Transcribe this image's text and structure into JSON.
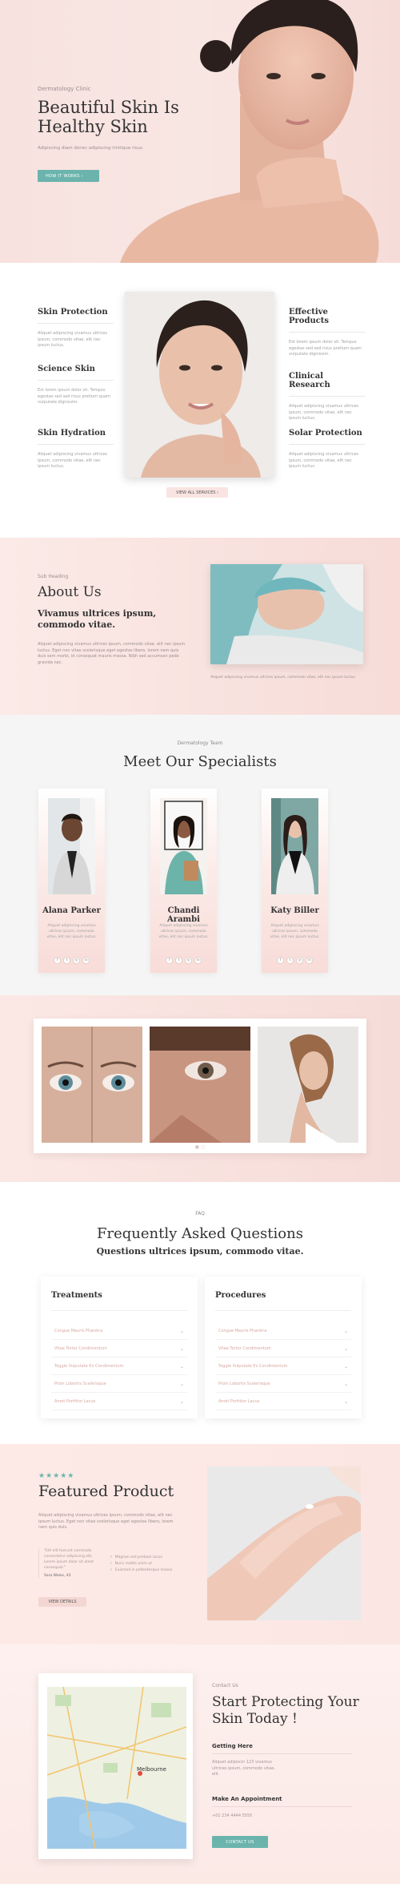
{
  "hero": {
    "eyebrow": "Dermatology Clinic",
    "title_line1": "Beautiful Skin Is",
    "title_line2": "Healthy Skin",
    "subtitle": "Adipiscing diam donec adipiscing tristique risus.",
    "cta": "HOW IT WORKS"
  },
  "services": {
    "left": [
      {
        "title": "Skin Protection",
        "text": "Aliquet adipiscing vivamus ultrices ipsum, commodo vitae, elit nec ipsum luctus."
      },
      {
        "title": "Science Skin",
        "text": "Est lorem ipsum dolor sit. Tempus egestas sed sed risus pretium quam vulputate dignissim."
      },
      {
        "title": "Skin Hydration",
        "text": "Aliquet adipiscing vivamus ultrices ipsum, commodo vitae, elit nec ipsum luctus."
      }
    ],
    "right": [
      {
        "title": "Effective Products",
        "text": "Est lorem ipsum dolor sit. Tempus egestas sed sed risus pretium quam vulputate dignissim."
      },
      {
        "title": "Clinical Research",
        "text": "Aliquet adipiscing vivamus ultrices ipsum, commodo vitae, elit nec ipsum luctus."
      },
      {
        "title": "Solar Protection",
        "text": "Aliquet adipiscing vivamus ultrices ipsum, commodo vitae, elit nec ipsum luctus."
      }
    ],
    "view_all": "VIEW ALL SERVICES"
  },
  "about": {
    "eyebrow": "Sub Heading",
    "title": "About Us",
    "subtitle": "Vivamus ultrices ipsum, commodo vitae.",
    "text": "Aliquet adipiscing vivamus ultrices ipsum, commodo vitae, elit nec ipsum luctus. Eget non vitae scelerisque eget egestas libero, lorem nam quis duis sem morbi, id consequat mauris massa. Nibh sed accumsan pede gravida nec.",
    "caption": "Aliquet adipiscing vivamus ultrices ipsum, commodo vitae, elit nec ipsum luctus."
  },
  "team": {
    "eyebrow": "Dermatology Team",
    "title": "Meet Our Specialists",
    "members": [
      {
        "name": "Alana Parker",
        "text": "Aliquet adipiscing vivamus ultrices ipsum, commodo vitae, elit nec ipsum luctus."
      },
      {
        "name": "Chandi Arambi",
        "text": "Aliquet adipiscing vivamus ultrices ipsum, commodo vitae, elit nec ipsum luctus."
      },
      {
        "name": "Katy Biller",
        "text": "Aliquet adipiscing vivamus ultrices ipsum, commodo vitae, elit nec ipsum luctus."
      }
    ]
  },
  "faq": {
    "eyebrow": "FAQ",
    "title": "Frequently Asked Questions",
    "subtitle": "Questions ultrices ipsum, commodo vitae.",
    "columns": [
      {
        "title": "Treatments",
        "items": [
          "Congue Mauris Pharetra",
          "Vitae Tortor Condimentum",
          "Toggle Vulputate Ex Condimentum",
          "Proin Lobortis Scelerisque",
          "Amet Porttitor Lacus"
        ]
      },
      {
        "title": "Procedures",
        "items": [
          "Congue Mauris Pharetra",
          "Vitae Tortor Condimentum",
          "Toggle Vulputate Ex Condimentum",
          "Proin Lobortis Scelerisque",
          "Amet Porttitor Lacus"
        ]
      }
    ]
  },
  "product": {
    "stars": "★★★★★",
    "title": "Featured Product",
    "text": "Aliquet adipiscing vivamus ultrices ipsum, commodo vitae, elit nec ipsum luctus. Eget non vitae scelerisque eget egestas libero, lorem nam quis duis.",
    "quote": "\"Elit elit fuerunt commodo consectetur adipiscing elit. Lorem ipsum dolor sit amet consequat.\"",
    "quote_by": "Sara Wales, 43",
    "checks": [
      "Magnas sed pretium lacus",
      "Nunc mattis enim ut",
      "Euismod in pellentesque massa"
    ],
    "button": "VIEW DETAILS"
  },
  "contact": {
    "eyebrow": "Contact Us",
    "title": "Start Protecting Your Skin Today !",
    "get_here_label": "Getting Here",
    "address": "Aliquet adipiscin 123 vivamus ultrices ipsum, commodo vitae, elit",
    "appt_label": "Make An Appointment",
    "phone": "+01 234 4444 5555",
    "button": "CONTACT US",
    "map_city": "Melbourne"
  }
}
